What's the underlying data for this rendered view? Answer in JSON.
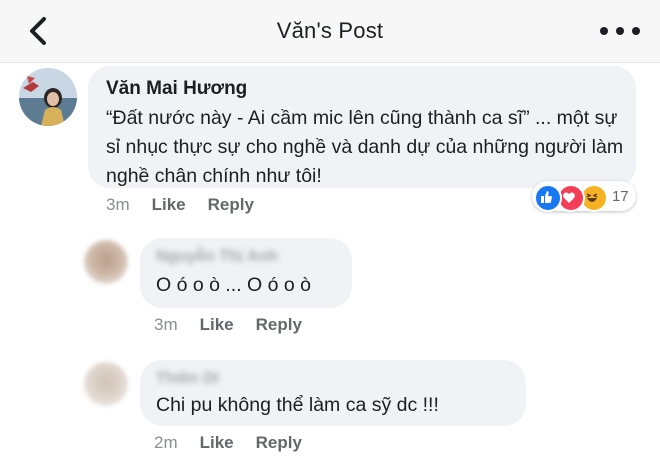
{
  "header": {
    "title": "Văn's Post",
    "back_icon": "chevron-left-icon",
    "more_icon": "more-horizontal-icon"
  },
  "comments": [
    {
      "author": "Văn Mai Hương",
      "text": "“Đất nước này - Ai cầm mic lên cũng thành ca sĩ” ... một sự sỉ nhục thực sự cho nghề và danh dự của những người làm nghề chân chính như tôi!",
      "time": "3m",
      "like_label": "Like",
      "reply_label": "Reply",
      "reactions": {
        "icons": [
          "like-icon",
          "love-icon",
          "haha-icon"
        ],
        "count": "17"
      }
    },
    {
      "author": "Nguyễn Thị Anh",
      "text": "O ó o ò ... O ó o ò",
      "time": "3m",
      "like_label": "Like",
      "reply_label": "Reply"
    },
    {
      "author": "Thiên Di",
      "text": "Chi pu không thể  làm ca sỹ  dc  !!!",
      "time": "2m",
      "like_label": "Like",
      "reply_label": "Reply"
    }
  ],
  "colors": {
    "bubble": "#f0f2f5",
    "like": "#1877f2",
    "love": "#f33e58",
    "haha": "#f7b125"
  }
}
